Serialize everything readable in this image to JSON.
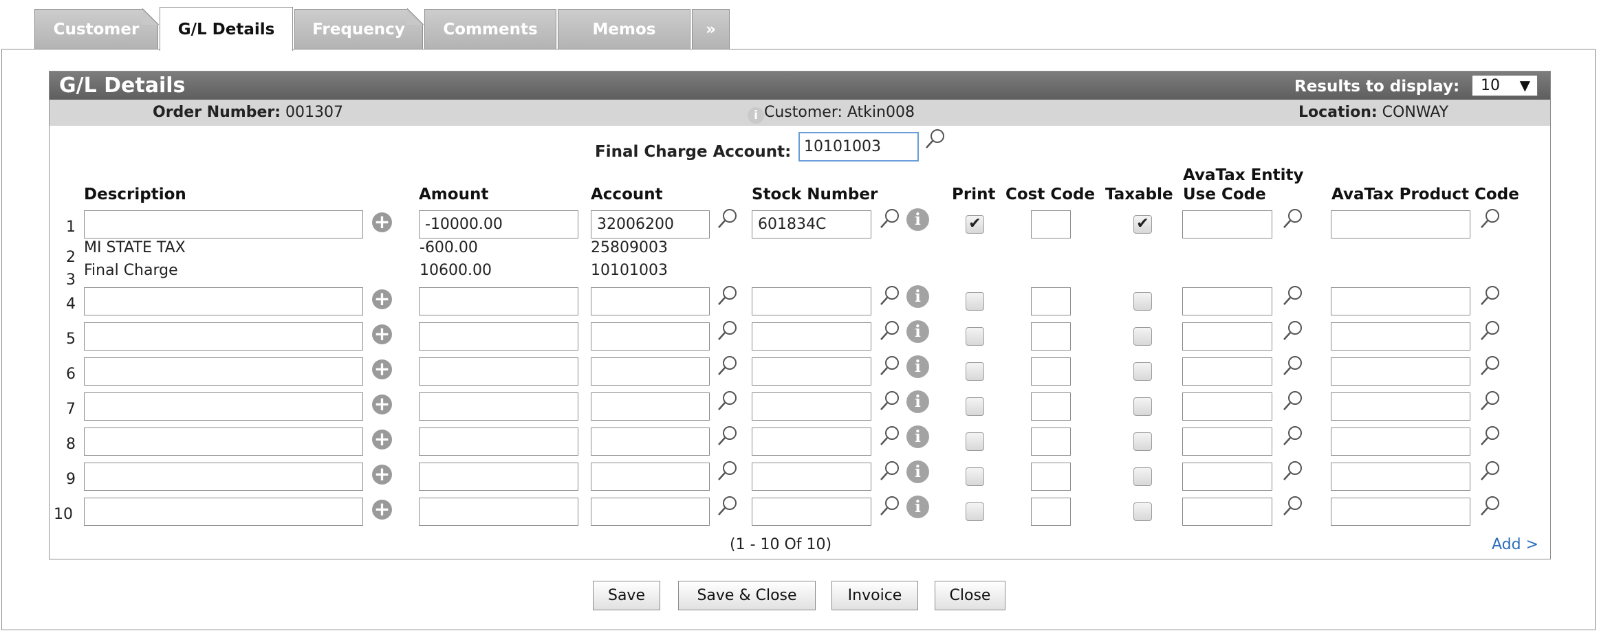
{
  "tabs": [
    "Customer",
    "G/L Details",
    "Frequency",
    "Comments",
    "Memos",
    "»"
  ],
  "panel": {
    "title": "G/L Details",
    "results_label": "Results to display:",
    "results_value": "10",
    "order_label": "Order Number:",
    "order_value": "001307",
    "customer_text": "Customer: Atkin008",
    "location_label": "Location:",
    "location_value": "CONWAY",
    "info_glyph": "i"
  },
  "final_charge": {
    "label": "Final Charge Account:",
    "value": "10101003"
  },
  "headers": {
    "description": "Description",
    "amount": "Amount",
    "account": "Account",
    "stock": "Stock Number",
    "print": "Print",
    "cost_code": "Cost Code",
    "taxable": "Taxable",
    "avatax_entity_1": "AvaTax Entity",
    "avatax_entity_2": "Use Code",
    "avatax_product": "AvaTax Product Code"
  },
  "rows": [
    {
      "num": "1",
      "description": "",
      "amount": "-10000.00",
      "account": "32006200",
      "stock": "601834C",
      "print": true,
      "taxable": true
    },
    {
      "num": "2",
      "description": "MI STATE TAX",
      "amount": "-600.00",
      "account": "25809003"
    },
    {
      "num": "3",
      "description": "Final Charge",
      "amount": "10600.00",
      "account": "10101003"
    },
    {
      "num": "4"
    },
    {
      "num": "5"
    },
    {
      "num": "6"
    },
    {
      "num": "7"
    },
    {
      "num": "8"
    },
    {
      "num": "9"
    },
    {
      "num": "10"
    }
  ],
  "pager": "(1 - 10 Of 10)",
  "add_link": "Add >",
  "buttons": {
    "save": "Save",
    "save_close": "Save & Close",
    "invoice": "Invoice",
    "close": "Close"
  },
  "colors": {
    "header_bar": "#6b6b6b",
    "info_bar": "#d6d6d6",
    "link": "#2a6ebb"
  }
}
